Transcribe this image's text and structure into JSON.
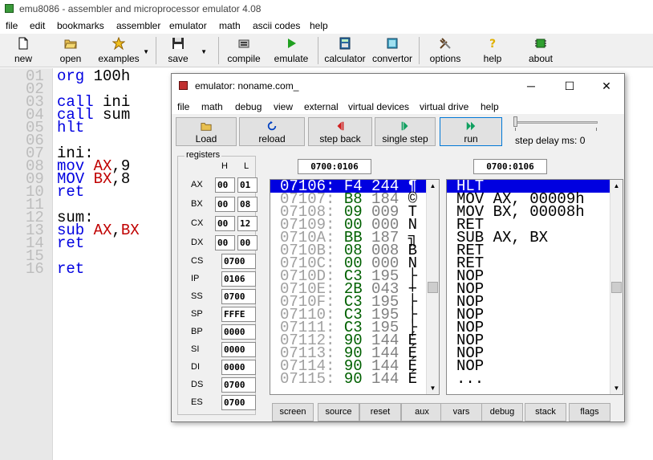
{
  "app": {
    "title": "emu8086 - assembler and microprocessor emulator 4.08"
  },
  "menu": [
    "file",
    "edit",
    "bookmarks",
    "assembler",
    "emulator",
    "math",
    "ascii codes",
    "help"
  ],
  "toolbar": {
    "new": "new",
    "open": "open",
    "examples": "examples",
    "save": "save",
    "compile": "compile",
    "emulate": "emulate",
    "calculator": "calculator",
    "convertor": "convertor",
    "options": "options",
    "help": "help",
    "about": "about"
  },
  "editor": {
    "line_numbers": [
      "01",
      "02",
      "03",
      "04",
      "05",
      "06",
      "07",
      "08",
      "09",
      "10",
      "11",
      "12",
      "13",
      "14",
      "15",
      "16"
    ],
    "lines": [
      [
        {
          "t": "org ",
          "c": "kw"
        },
        {
          "t": "100h",
          "c": "num"
        }
      ],
      [],
      [
        {
          "t": "call ",
          "c": "kw"
        },
        {
          "t": "ini",
          "c": "num"
        }
      ],
      [
        {
          "t": "call ",
          "c": "kw"
        },
        {
          "t": "sum",
          "c": "num"
        }
      ],
      [
        {
          "t": "hlt",
          "c": "kw"
        }
      ],
      [],
      [
        {
          "t": "ini:",
          "c": "num"
        }
      ],
      [
        {
          "t": "mov ",
          "c": "kw"
        },
        {
          "t": "AX",
          "c": "reg"
        },
        {
          "t": ",9",
          "c": "num"
        }
      ],
      [
        {
          "t": "MOV ",
          "c": "kw"
        },
        {
          "t": "BX",
          "c": "reg"
        },
        {
          "t": ",8",
          "c": "num"
        }
      ],
      [
        {
          "t": "ret",
          "c": "kw"
        }
      ],
      [],
      [
        {
          "t": "sum:",
          "c": "num"
        }
      ],
      [
        {
          "t": "sub ",
          "c": "kw"
        },
        {
          "t": "AX",
          "c": "reg"
        },
        {
          "t": ",",
          "c": "num"
        },
        {
          "t": "BX",
          "c": "reg"
        }
      ],
      [
        {
          "t": "ret",
          "c": "kw"
        }
      ],
      [],
      [
        {
          "t": "ret",
          "c": "kw"
        }
      ]
    ]
  },
  "emulator": {
    "title": "emulator: noname.com_",
    "menu": [
      "file",
      "math",
      "debug",
      "view",
      "external",
      "virtual devices",
      "virtual drive",
      "help"
    ],
    "buttons": {
      "load": "Load",
      "reload": "reload",
      "step_back": "step back",
      "single_step": "single step",
      "run": "run"
    },
    "step_delay": "step delay ms: 0",
    "registers_title": "registers",
    "h_label": "H",
    "l_label": "L",
    "pair_regs": [
      {
        "name": "AX",
        "h": "00",
        "l": "01"
      },
      {
        "name": "BX",
        "h": "00",
        "l": "08"
      },
      {
        "name": "CX",
        "h": "00",
        "l": "12"
      },
      {
        "name": "DX",
        "h": "00",
        "l": "00"
      }
    ],
    "seg_regs": [
      {
        "name": "CS",
        "val": "0700"
      },
      {
        "name": "IP",
        "val": "0106"
      },
      {
        "name": "SS",
        "val": "0700"
      },
      {
        "name": "SP",
        "val": "FFFE"
      },
      {
        "name": "BP",
        "val": "0000"
      },
      {
        "name": "SI",
        "val": "0000"
      },
      {
        "name": "DI",
        "val": "0000"
      },
      {
        "name": "DS",
        "val": "0700"
      },
      {
        "name": "ES",
        "val": "0700"
      }
    ],
    "mem_address": "0700:0106",
    "dis_address": "0700:0106",
    "memory": [
      {
        "a": "07106:",
        "h": "F4",
        "d": "244",
        "c": "¶"
      },
      {
        "a": "07107:",
        "h": "B8",
        "d": "184",
        "c": "©"
      },
      {
        "a": "07108:",
        "h": "09",
        "d": "009",
        "c": "T"
      },
      {
        "a": "07109:",
        "h": "00",
        "d": "000",
        "c": "N"
      },
      {
        "a": "0710A:",
        "h": "BB",
        "d": "187",
        "c": "╗"
      },
      {
        "a": "0710B:",
        "h": "08",
        "d": "008",
        "c": "B"
      },
      {
        "a": "0710C:",
        "h": "00",
        "d": "000",
        "c": "N"
      },
      {
        "a": "0710D:",
        "h": "C3",
        "d": "195",
        "c": "├"
      },
      {
        "a": "0710E:",
        "h": "2B",
        "d": "043",
        "c": "+"
      },
      {
        "a": "0710F:",
        "h": "C3",
        "d": "195",
        "c": "├"
      },
      {
        "a": "07110:",
        "h": "C3",
        "d": "195",
        "c": "├"
      },
      {
        "a": "07111:",
        "h": "C3",
        "d": "195",
        "c": "├"
      },
      {
        "a": "07112:",
        "h": "90",
        "d": "144",
        "c": "É"
      },
      {
        "a": "07113:",
        "h": "90",
        "d": "144",
        "c": "É"
      },
      {
        "a": "07114:",
        "h": "90",
        "d": "144",
        "c": "É"
      },
      {
        "a": "07115:",
        "h": "90",
        "d": "144",
        "c": "É"
      }
    ],
    "disassembly": [
      "HLT",
      "MOV AX, 00009h",
      "MOV BX, 00008h",
      "RET",
      "SUB AX, BX",
      "RET",
      "RET",
      "NOP",
      "NOP",
      "NOP",
      "NOP",
      "NOP",
      "NOP",
      "NOP",
      "NOP",
      "..."
    ],
    "bottom_buttons": [
      "screen",
      "source",
      "reset",
      "aux",
      "vars",
      "debug",
      "stack",
      "flags"
    ]
  },
  "colors": {
    "keyword": "#0000e0",
    "register": "#c00000",
    "hex": "#006000",
    "selection": "#0000e0"
  }
}
